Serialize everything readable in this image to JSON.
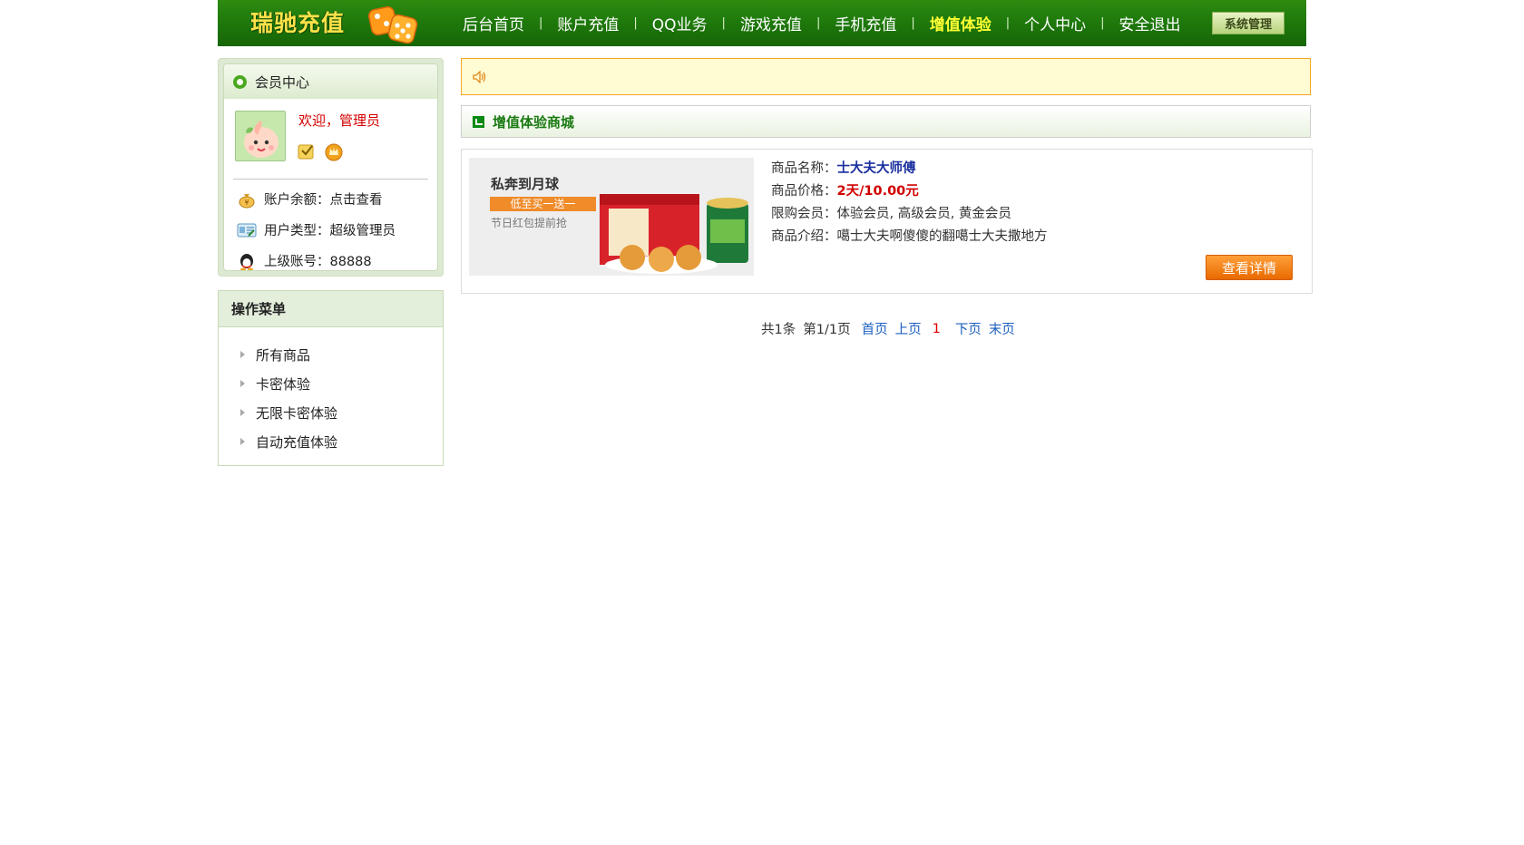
{
  "header": {
    "logo": "瑞驰充值",
    "nav": [
      "后台首页",
      "账户充值",
      "QQ业务",
      "游戏充值",
      "手机充值",
      "增值体验",
      "个人中心",
      "安全退出"
    ],
    "active_index": 5,
    "system_button": "系统管理"
  },
  "member": {
    "title": "会员中心",
    "welcome": "欢迎，管理员",
    "balance": "账户余额：点击查看",
    "user_type": "用户类型：超级管理员",
    "parent": "上级账号：88888"
  },
  "menu": {
    "title": "操作菜单",
    "items": [
      "所有商品",
      "卡密体验",
      "无限卡密体验",
      "自动充值体验"
    ]
  },
  "section": {
    "title": "增值体验商城"
  },
  "product": {
    "image": {
      "title": "私奔到月球",
      "tag": "低至买一送一",
      "sub": "节日红包提前抢"
    },
    "name_label": "商品名称：",
    "name": "士大夫大师傅",
    "price_label": "商品价格：",
    "price": "2天/10.00元",
    "members_label": "限购会员：",
    "members": "体验会员, 高级会员, 黄金会员",
    "desc_label": "商品介绍：",
    "desc": "噶士大夫啊傻傻的翻噶士大夫撒地方",
    "detail_button": "查看详情"
  },
  "pager": {
    "total": "共1条",
    "page": "第1/1页",
    "first": "首页",
    "prev": "上页",
    "current": "1",
    "next": "下页",
    "last": "末页"
  },
  "colors": {
    "header_green": "#1f7a0c",
    "active_nav": "#ffff33",
    "price_red": "#d10000",
    "link_blue": "#1c5fbf",
    "button_orange": "#f08b2a"
  }
}
